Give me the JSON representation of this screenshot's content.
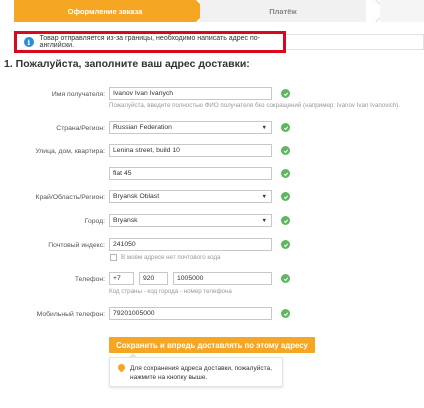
{
  "steps": {
    "active": "Оформление заказа",
    "next": "Платёж"
  },
  "notice": "Товар отправляется из-за границы, необходимо написать адрес по-английски.",
  "title": "1. Пожалуйста, заполните ваш адрес доставки:",
  "fields": {
    "name": {
      "label": "Имя получателя:",
      "value": "Ivanov Ivan Ivanych",
      "hint": "Пожалуйста, введите полностью ФИО получателя без сокращений (например: Ivanov Ivan Ivanovich)."
    },
    "country": {
      "label": "Страна/Регион:",
      "value": "Russian Federation"
    },
    "street": {
      "label": "Улица, дом, квартира:",
      "value": "Lenina street, build 10",
      "value2": "flat 45"
    },
    "region": {
      "label": "Край/Область/Регион:",
      "value": "Bryansk Oblast"
    },
    "city": {
      "label": "Город:",
      "value": "Bryansk"
    },
    "zip": {
      "label": "Почтовый индекс:",
      "value": "241050",
      "no_zip_label": "В моём адресе нет почтового кода"
    },
    "phone": {
      "label": "Телефон:",
      "country_code": "+7",
      "area_code": "920",
      "number": "1005000",
      "hint": "Код страны - код города - номер телефона"
    },
    "mobile": {
      "label": "Мобильный телефон:",
      "value": "79201005000"
    }
  },
  "save_button": "Сохранить и впредь доставлять по этому адресу",
  "tip": "Для сохранения адреса доставки, пожалуйста, нажмите на кнопку выше.",
  "colors": {
    "accent": "#f5a623",
    "alert_border": "#d9091d",
    "check": "#5cb85c",
    "info": "#2d8bd8"
  }
}
